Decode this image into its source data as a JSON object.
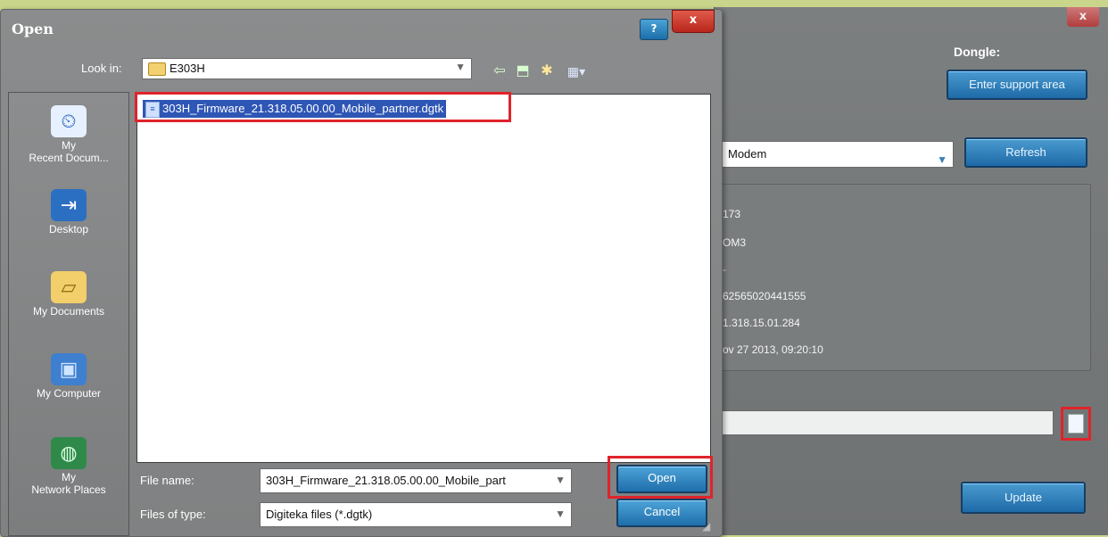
{
  "background_app": {
    "close_label": "x",
    "dongle_label": "Dongle:",
    "enter_support_button": "Enter support area",
    "device_select": "Modem",
    "refresh_button": "Refresh",
    "info_lines": [
      "173",
      "OM3",
      "-",
      "62565020441555",
      "1.318.15.01.284",
      "ov 27 2013, 09:20:10"
    ],
    "file_path_value": "",
    "update_button": "Update"
  },
  "dialog": {
    "title": "Open",
    "help_label": "?",
    "close_label": "x",
    "look_in_label": "Look in:",
    "look_in_value": "E303H",
    "toolbar_icons": [
      "back-icon",
      "up-folder-icon",
      "new-folder-icon",
      "view-menu-icon"
    ],
    "places": [
      {
        "name": "recent-documents",
        "label_line1": "My",
        "label_line2": "Recent Docum...",
        "icon": "recent-documents-icon"
      },
      {
        "name": "desktop",
        "label_line1": "",
        "label_line2": "Desktop",
        "icon": "desktop-icon"
      },
      {
        "name": "my-documents",
        "label_line1": "",
        "label_line2": "My Documents",
        "icon": "documents-icon"
      },
      {
        "name": "my-computer",
        "label_line1": "",
        "label_line2": "My Computer",
        "icon": "computer-icon"
      },
      {
        "name": "network-places",
        "label_line1": "My",
        "label_line2": "Network Places",
        "icon": "network-icon"
      }
    ],
    "files": [
      {
        "name": "303H_Firmware_21.318.05.00.00_Mobile_partner.dgtk",
        "selected": true
      }
    ],
    "file_name_label": "File name:",
    "file_name_value": "303H_Firmware_21.318.05.00.00_Mobile_part",
    "files_of_type_label": "Files of type:",
    "files_of_type_value": "Digiteka files (*.dgtk)",
    "open_button": "Open",
    "cancel_button": "Cancel"
  },
  "colors": {
    "accent_blue": "#1f6eab",
    "highlight_red": "#e0232b",
    "selection": "#2e56b5"
  }
}
